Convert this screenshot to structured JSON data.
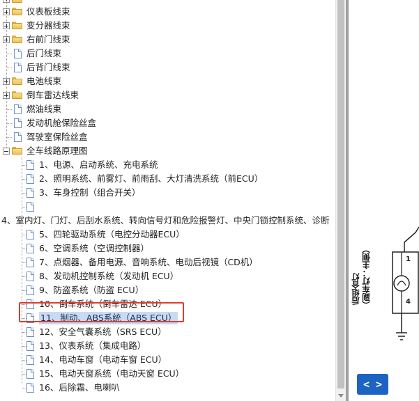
{
  "tree": {
    "top_items": [
      {
        "label": "仪表板线束",
        "type": "folder",
        "expander": "plus"
      },
      {
        "label": "变分器线束",
        "type": "folder",
        "expander": "plus"
      },
      {
        "label": "右前门线束",
        "type": "folder",
        "expander": "plus"
      },
      {
        "label": "后门线束",
        "type": "doc"
      },
      {
        "label": "后背门线束",
        "type": "doc"
      },
      {
        "label": "电池线束",
        "type": "folder",
        "expander": "plus"
      },
      {
        "label": "倒车雷达线束",
        "type": "folder",
        "expander": "plus"
      },
      {
        "label": "燃油线束",
        "type": "doc"
      },
      {
        "label": "发动机舱保险丝盒",
        "type": "doc"
      },
      {
        "label": "驾驶室保险丝盒",
        "type": "doc"
      },
      {
        "label": "全车线路原理图",
        "type": "folder",
        "expander": "minus"
      }
    ],
    "children": [
      "1、电源、启动系统、充电系统",
      "2、照明系统、前雾灯、前雨刮、大灯清洗系统（前ECU）",
      "3、车身控制（组合开关）",
      "",
      "4、室内灯、门灯、后刮水系统、转向信号灯和危险报警灯、中央门锁控制系统、诊断",
      "5、四轮驱动系统（电控分动器ECU）",
      "6、空调系统（空调控制器）",
      "7、点烟器、备用电源、音响系统、电动后视镜（CD机）",
      "8、发动机控制系统（发动机 ECU）",
      "9、防盗系统（防盗 ECU）",
      "10、倒车系统（倒车雷达 ECU）",
      "11、制动、ABS系统（ABS ECU）",
      "12、安全气囊系统（SRS ECU）",
      "13、仪表系统（集成电路）",
      "14、电动车窗（电动车窗 ECU）",
      "15、电动天窗系统（电动天窗 ECU）",
      "16、后除霜、电喇叭"
    ],
    "selected_index": 11,
    "highlight_color": "#e23b2e",
    "selection_color": "#c9daf2"
  },
  "diagram": {
    "label_line1": "后组合灯",
    "label_line2": "（副车灯：主侧）",
    "pin_top": "1",
    "pin_bottom": "4"
  },
  "nav": {
    "label": "< >",
    "color": "#1d64c2"
  }
}
